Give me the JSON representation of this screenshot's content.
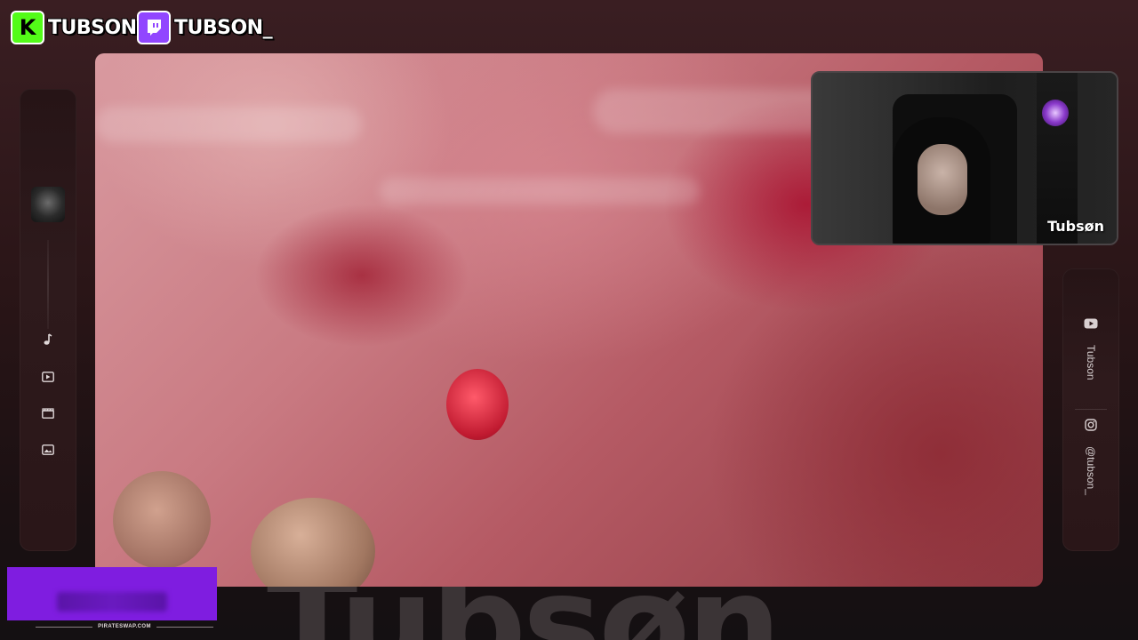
{
  "socials": {
    "kick": {
      "logo": "K",
      "handle": "TUBSON",
      "color": "#53fc18"
    },
    "twitch": {
      "handle": "TUBSON_",
      "color": "#9146ff"
    }
  },
  "left_panel": {
    "icons": [
      "music-note-icon",
      "play-video-icon",
      "clapperboard-icon",
      "image-icon"
    ]
  },
  "right_panel": {
    "youtube": {
      "icon": "youtube-icon",
      "label": "Tubson"
    },
    "instagram": {
      "icon": "instagram-icon",
      "label": "@tubson_"
    }
  },
  "webcam": {
    "name": "Tubsøn"
  },
  "background_watermark": "Tubsøn",
  "banner": {
    "site": "PIRATESWAP.COM",
    "color": "#7f1de0"
  }
}
